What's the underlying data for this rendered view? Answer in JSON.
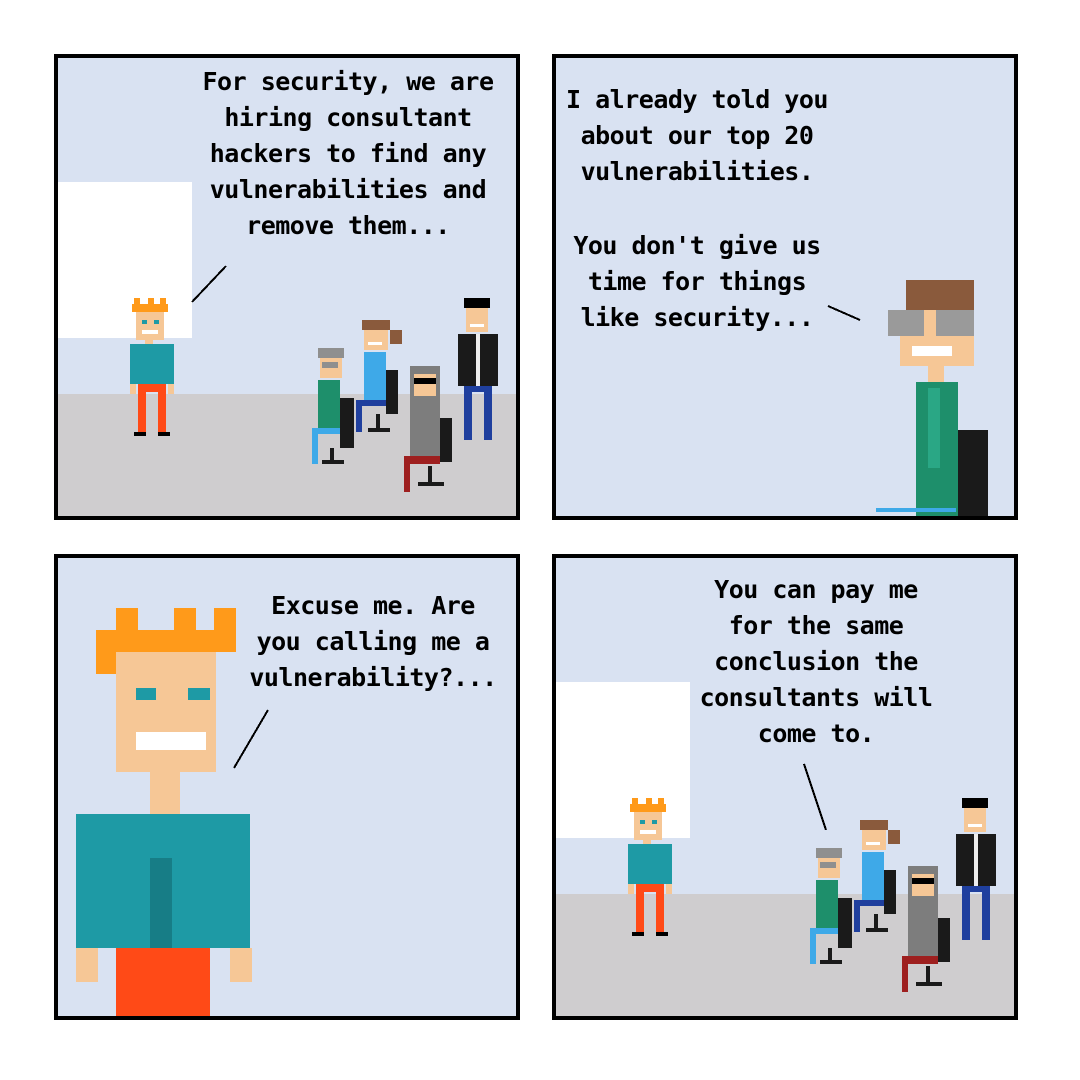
{
  "panels": [
    {
      "speech": [
        "For security, we are\nhiring consultant\nhackers to find any\nvulnerabilities and\nremove them..."
      ]
    },
    {
      "speech": [
        "I already told you\nabout our top 20\nvulnerabilities.",
        "You don't give us\ntime for things\nlike security..."
      ]
    },
    {
      "speech": [
        "Excuse me. Are\nyou calling me a\nvulnerability?..."
      ]
    },
    {
      "speech": [
        "You can pay me\nfor the same\nconclusion the\nconsultants will\ncome to."
      ]
    }
  ],
  "colors": {
    "wall": "#d9e2f2",
    "floor": "#cfcdcf",
    "window": "#ffffff",
    "skin": "#f6c796",
    "orange_hair": "#ff9a1a",
    "teal_shirt": "#1e9aa5",
    "red_pants": "#ff4a17",
    "green_shirt": "#1e8f6b",
    "grey_hair": "#8f8f8f",
    "brown_hair": "#8a5a3c",
    "blue_shirt": "#3ea9e8",
    "hoodie": "#7d7d7d",
    "black_jacket": "#1a1a1a",
    "navy_pants": "#1f3f9e",
    "dark_red": "#9e1f1f",
    "chair": "#1a1a1a"
  }
}
